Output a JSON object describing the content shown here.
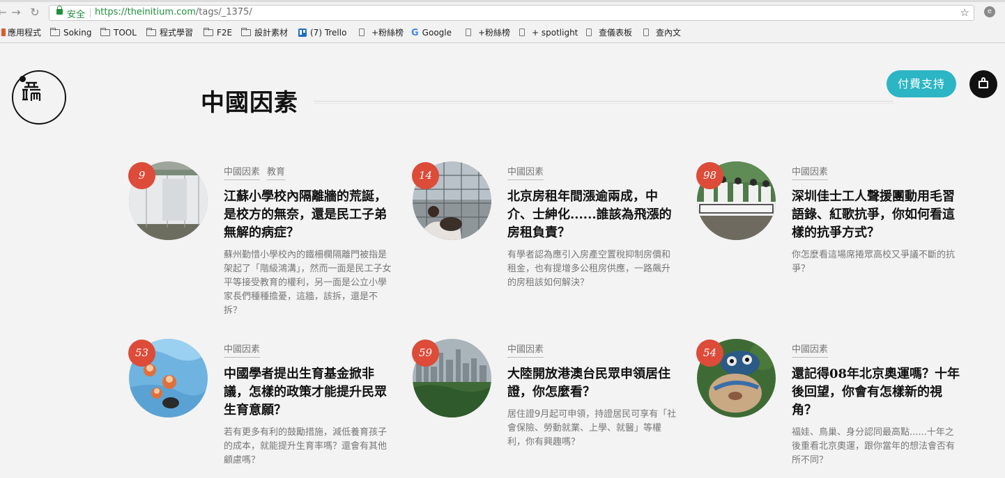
{
  "browser": {
    "secure_label": "安全",
    "url_host": "https://theinitium.com",
    "url_path": "/tags/_1375/",
    "bookmarks": [
      "應用程式",
      "Soking",
      "TOOL",
      "程式學習",
      "F2E",
      "設計素材",
      "(7) Trello",
      "+粉絲榜",
      "Google",
      "+粉絲榜",
      "+ spotlight",
      "查儀表板",
      "查內文"
    ]
  },
  "site": {
    "logo_glyph": "出\n而",
    "tag_title": "中國因素",
    "support_label": "付費支持"
  },
  "articles": [
    {
      "count": "9",
      "tags": [
        "中國因素",
        "教育"
      ],
      "title": "江蘇小學校內隔離牆的荒誕，是校方的無奈，還是民工子弟無解的病症？",
      "summary": "蘇州勤惜小學校內的鐵柵欄隔離門被指是架起了「階級鴻溝」，然而一面是民工子女平等接受教育的權利，另一面是公立小學家長們種種擔憂，這牆，該拆，還是不拆？"
    },
    {
      "count": "14",
      "tags": [
        "中國因素"
      ],
      "title": "北京房租年間漲逾兩成，中介、士紳化......誰該為飛漲的房租負責？",
      "summary": "有學者認為應引入房產空置稅抑制房價和租金，也有提增多公租房供應，一路飆升的房租該如何解決？"
    },
    {
      "count": "98",
      "tags": [
        "中國因素"
      ],
      "title": "深圳佳士工人聲援團動用毛習語錄、紅歌抗爭，你如何看這樣的抗爭方式？",
      "summary": "你怎麼看這場席捲眾高校又爭議不斷的抗爭？"
    },
    {
      "count": "53",
      "tags": [
        "中國因素"
      ],
      "title": "中國學者提出生育基金掀非議，怎樣的政策才能提升民眾生育意願？",
      "summary": "若有更多有利的鼓勵措施，減低養育孩子的成本，就能提升生育率嗎？還會有其他顧慮嗎？"
    },
    {
      "count": "59",
      "tags": [
        "中國因素"
      ],
      "title": "大陸開放港澳台民眾申領居住證，你怎麼看？",
      "summary": "居住證9月起可申領，持證居民可享有「社會保險、勞動就業、上學、就醫」等權利，你有興趣嗎？"
    },
    {
      "count": "54",
      "tags": [
        "中國因素"
      ],
      "title": "還記得08年北京奧運嗎？十年後回望，你會有怎樣新的視角？",
      "summary": "福娃、鳥巢、身分認同最高點......十年之後重看北京奧運，跟你當年的想法會否有所不同？"
    }
  ]
}
